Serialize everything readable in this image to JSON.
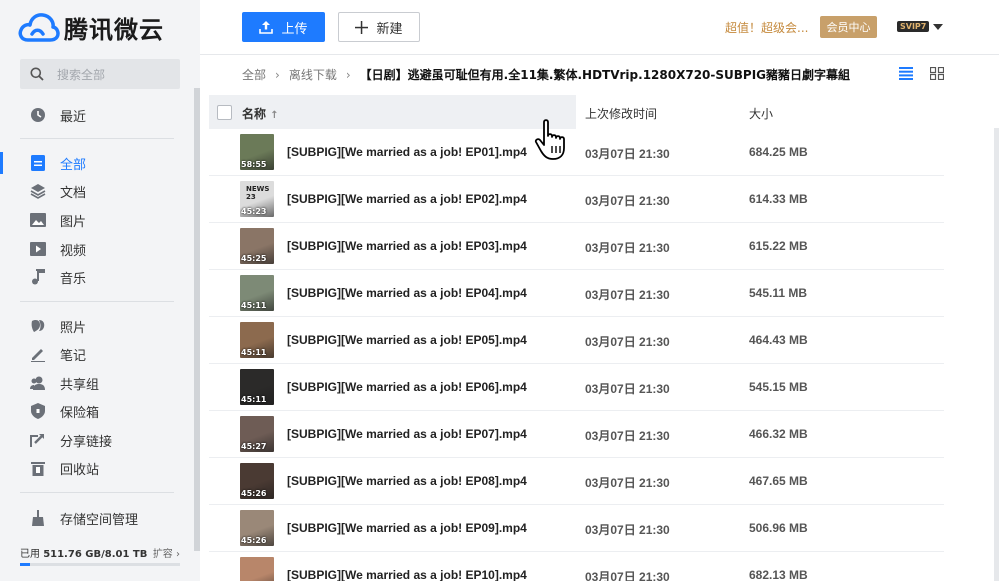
{
  "app": {
    "name": "腾讯微云"
  },
  "sidebar": {
    "search_placeholder": "搜索全部",
    "items": [
      {
        "label": "最近",
        "icon": "clock-icon"
      },
      {
        "label": "全部",
        "icon": "file-icon",
        "active": true
      },
      {
        "label": "文档",
        "icon": "layers-icon"
      },
      {
        "label": "图片",
        "icon": "image-icon"
      },
      {
        "label": "视频",
        "icon": "play-icon"
      },
      {
        "label": "音乐",
        "icon": "music-note-icon"
      },
      {
        "label": "照片",
        "icon": "leaf-icon"
      },
      {
        "label": "笔记",
        "icon": "pen-icon"
      },
      {
        "label": "共享组",
        "icon": "users-icon"
      },
      {
        "label": "保险箱",
        "icon": "shield-icon"
      },
      {
        "label": "分享链接",
        "icon": "share-icon"
      },
      {
        "label": "回收站",
        "icon": "trash-icon"
      },
      {
        "label": "存储空间管理",
        "icon": "broom-icon"
      }
    ],
    "storage": {
      "used_label": "已用",
      "used": "511.76 GB",
      "total": "8.01 TB",
      "expand_label": "扩容",
      "used_fraction": 0.062
    }
  },
  "toolbar": {
    "upload_label": "上传",
    "new_label": "新建",
    "promo_text": "超值！超级会...",
    "vip_center_label": "会员中心",
    "svip_label": "SVIP7"
  },
  "breadcrumb": {
    "items": [
      "全部",
      "离线下载"
    ],
    "current": "【日剧】逃避虽可耻但有用.全11集.繁体.HDTVrip.1280X720-SUBPIG豬豬日劇字幕組"
  },
  "table": {
    "headers": {
      "name": "名称",
      "date": "上次修改时间",
      "size": "大小"
    },
    "rows": [
      {
        "name": "[SUBPIG][We married as a job! EP01].mp4",
        "date": "03月07日 21:30",
        "size": "684.25 MB",
        "duration": "58:55",
        "thumb": "#6b7a58"
      },
      {
        "name": "[SUBPIG][We married as a job! EP02].mp4",
        "date": "03月07日 21:30",
        "size": "614.33 MB",
        "duration": "45:23",
        "thumb": "#dcdcdc",
        "thumb_text": "NEWS 23"
      },
      {
        "name": "[SUBPIG][We married as a job! EP03].mp4",
        "date": "03月07日 21:30",
        "size": "615.22 MB",
        "duration": "45:25",
        "thumb": "#8a7566"
      },
      {
        "name": "[SUBPIG][We married as a job! EP04].mp4",
        "date": "03月07日 21:30",
        "size": "545.11 MB",
        "duration": "45:11",
        "thumb": "#7d8a76"
      },
      {
        "name": "[SUBPIG][We married as a job! EP05].mp4",
        "date": "03月07日 21:30",
        "size": "464.43 MB",
        "duration": "45:11",
        "thumb": "#8c6a4e"
      },
      {
        "name": "[SUBPIG][We married as a job! EP06].mp4",
        "date": "03月07日 21:30",
        "size": "545.15 MB",
        "duration": "45:11",
        "thumb": "#2b2a29"
      },
      {
        "name": "[SUBPIG][We married as a job! EP07].mp4",
        "date": "03月07日 21:30",
        "size": "466.32 MB",
        "duration": "45:27",
        "thumb": "#6e5c55"
      },
      {
        "name": "[SUBPIG][We married as a job! EP08].mp4",
        "date": "03月07日 21:30",
        "size": "467.65 MB",
        "duration": "45:26",
        "thumb": "#4a3a33"
      },
      {
        "name": "[SUBPIG][We married as a job! EP09].mp4",
        "date": "03月07日 21:30",
        "size": "506.96 MB",
        "duration": "45:26",
        "thumb": "#9a8878"
      },
      {
        "name": "[SUBPIG][We married as a job! EP10].mp4",
        "date": "03月07日 21:30",
        "size": "682.13 MB",
        "duration": "",
        "thumb": "#b8866a"
      }
    ]
  },
  "colors": {
    "accent": "#1e7bff",
    "vip": "#c8a06a",
    "promo": "#c58a3d"
  }
}
